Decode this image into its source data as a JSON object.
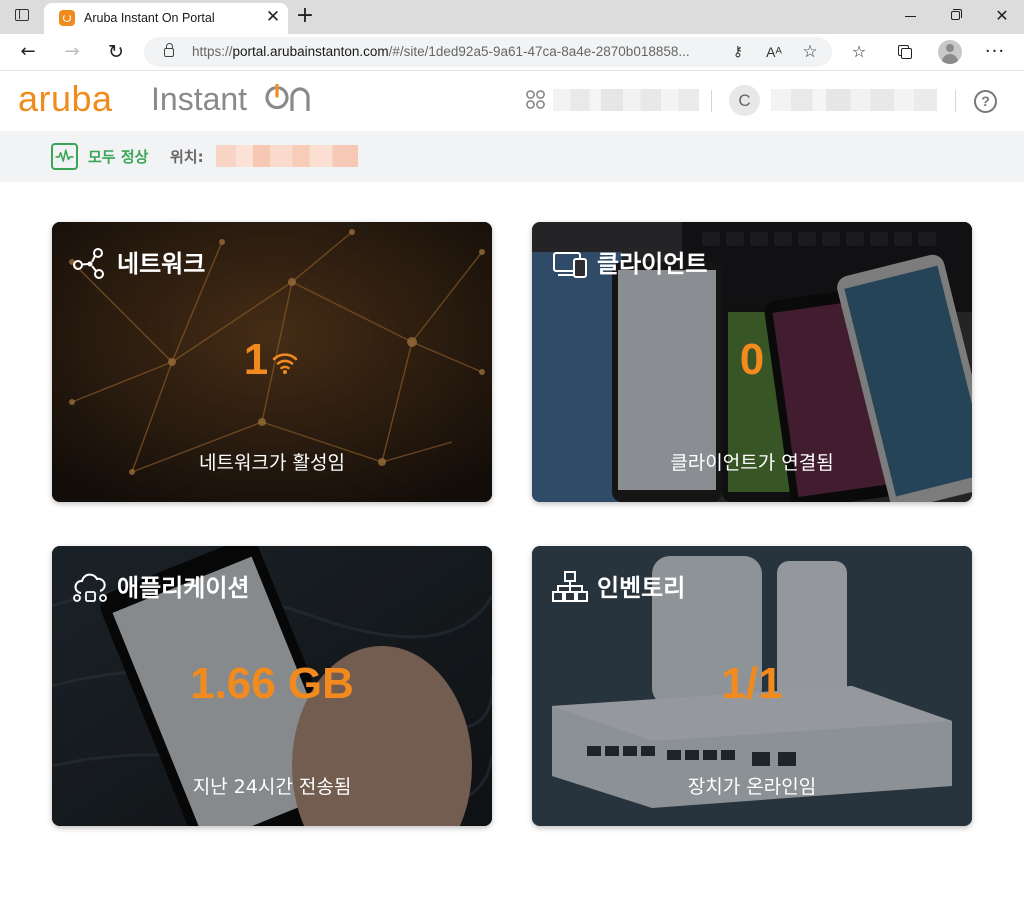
{
  "browser": {
    "tab_title": "Aruba Instant On Portal",
    "url_prefix": "https://",
    "url_domain": "portal.arubainstanton.com",
    "url_rest": "/#/site/1ded92a5-9a61-47ca-8a4e-2870b018858...",
    "reader_label": "Aᴬ"
  },
  "header": {
    "logo_brand": "aruba",
    "logo_product": "Instant",
    "account_initial": "C",
    "brand_color": "#f08c1e"
  },
  "status": {
    "health_text": "모두 정상",
    "location_label": "위치:",
    "health_color": "#3aa557"
  },
  "cards": {
    "network": {
      "title": "네트워크",
      "value": "1",
      "subtitle": "네트워크가 활성임",
      "icon": "network-nodes-icon"
    },
    "clients": {
      "title": "클라이언트",
      "value": "0",
      "subtitle": "클라이언트가 연결됨",
      "icon": "devices-icon"
    },
    "applications": {
      "title": "애플리케이션",
      "value": "1.66 GB",
      "subtitle": "지난 24시간 전송됨",
      "icon": "cloud-apps-icon"
    },
    "inventory": {
      "title": "인벤토리",
      "value": "1/1",
      "subtitle": "장치가 온라인임",
      "icon": "hierarchy-icon"
    }
  },
  "accent_color": "#f28a1e"
}
